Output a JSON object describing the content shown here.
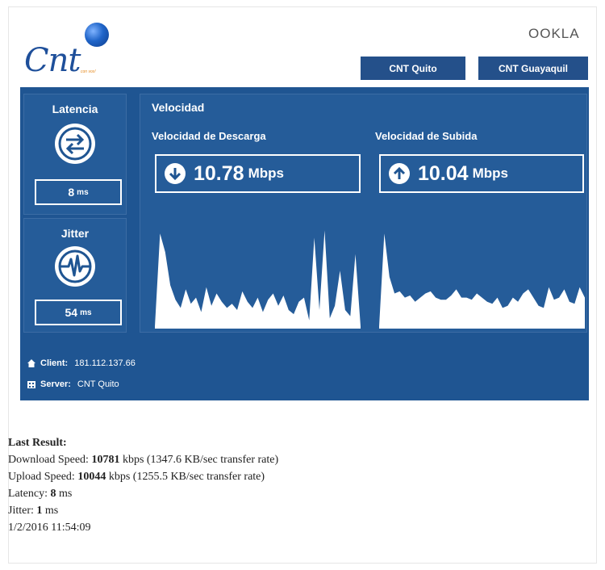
{
  "header": {
    "logo_text": "Cnt",
    "logo_tagline": "con vos!",
    "brand": "OOKLA",
    "servers": [
      {
        "label": "CNT Quito"
      },
      {
        "label": "CNT Guayaquil"
      }
    ]
  },
  "latency": {
    "title": "Latencia",
    "value": "8",
    "unit": "ms"
  },
  "jitter": {
    "title": "Jitter",
    "value": "54",
    "unit": "ms"
  },
  "velocity": {
    "title": "Velocidad",
    "download": {
      "title": "Velocidad de Descarga",
      "value": "10.78",
      "unit": "Mbps"
    },
    "upload": {
      "title": "Velocidad de Subida",
      "value": "10.04",
      "unit": "Mbps"
    }
  },
  "graphs": {
    "download_series": [
      0.02,
      0.92,
      0.74,
      0.42,
      0.28,
      0.2,
      0.38,
      0.24,
      0.3,
      0.16,
      0.4,
      0.22,
      0.34,
      0.26,
      0.2,
      0.24,
      0.18,
      0.36,
      0.26,
      0.2,
      0.3,
      0.16,
      0.28,
      0.34,
      0.22,
      0.32,
      0.18,
      0.14,
      0.26,
      0.3,
      0.08,
      0.88,
      0.18,
      0.95,
      0.1,
      0.22,
      0.56,
      0.18,
      0.12,
      0.72,
      0.02
    ],
    "upload_series": [
      0.02,
      0.92,
      0.5,
      0.34,
      0.36,
      0.3,
      0.32,
      0.26,
      0.3,
      0.34,
      0.36,
      0.3,
      0.28,
      0.28,
      0.32,
      0.38,
      0.3,
      0.3,
      0.28,
      0.34,
      0.3,
      0.26,
      0.24,
      0.3,
      0.2,
      0.22,
      0.3,
      0.26,
      0.34,
      0.38,
      0.3,
      0.22,
      0.2,
      0.4,
      0.28,
      0.3,
      0.38,
      0.26,
      0.24,
      0.4,
      0.3
    ]
  },
  "client": {
    "label": "Client:",
    "value": "181.112.137.66"
  },
  "server": {
    "label": "Server:",
    "value": "CNT Quito"
  },
  "last_result": {
    "heading": "Last Result:",
    "download_label": "Download Speed:",
    "download_value": "10781",
    "download_rest": "kbps (1347.6 KB/sec transfer rate)",
    "upload_label": "Upload Speed:",
    "upload_value": "10044",
    "upload_rest": "kbps (1255.5 KB/sec transfer rate)",
    "latency_label": "Latency:",
    "latency_value": "8",
    "latency_unit": "ms",
    "jitter_label": "Jitter:",
    "jitter_value": "1",
    "jitter_unit": "ms",
    "timestamp": "1/2/2016 11:54:09"
  },
  "colors": {
    "panel": "#1f5592",
    "box": "#255c99",
    "button": "#24508a",
    "logo_blue": "#1e4f9a"
  }
}
